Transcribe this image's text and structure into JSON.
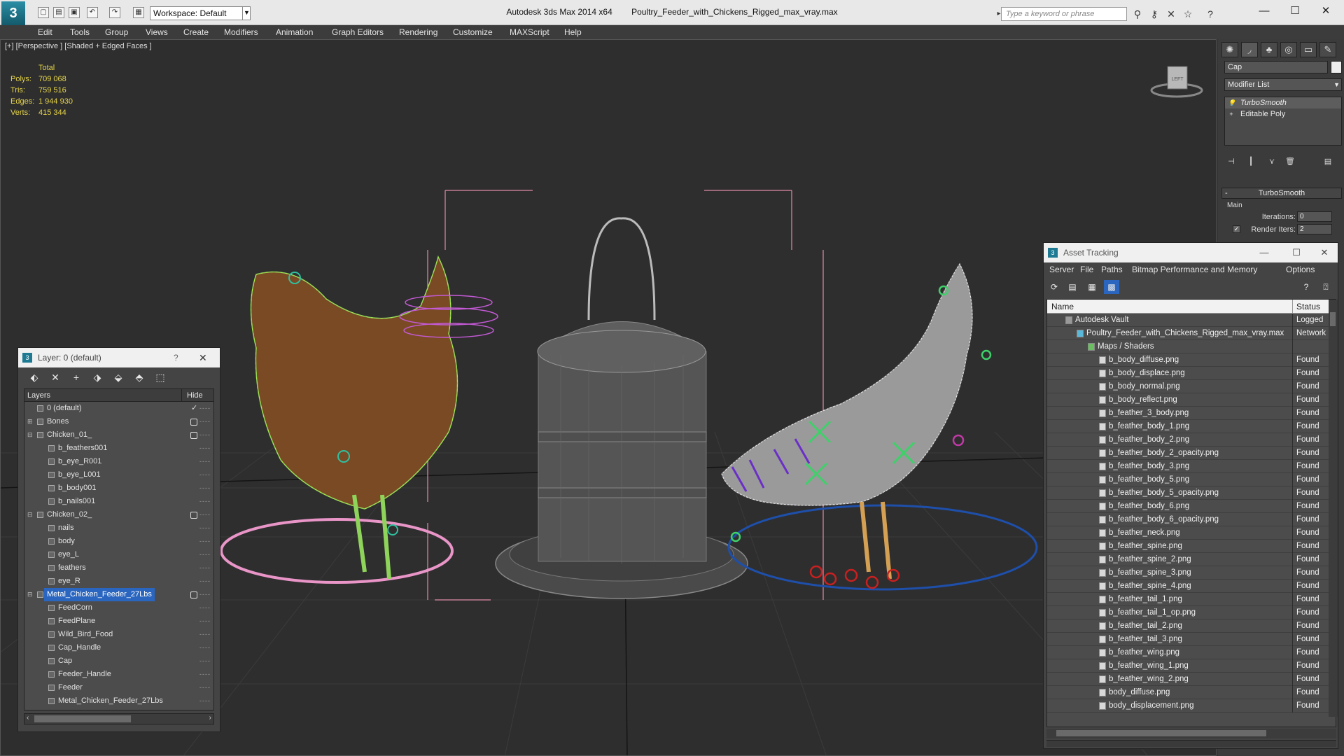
{
  "app": {
    "logo": "3",
    "workspace": "Workspace: Default",
    "product": "Autodesk 3ds Max  2014 x64",
    "file": "Poultry_Feeder_with_Chickens_Rigged_max_vray.max",
    "search_placeholder": "Type a keyword or phrase"
  },
  "menu": [
    "Edit",
    "Tools",
    "Group",
    "Views",
    "Create",
    "Modifiers",
    "Animation",
    "Graph Editors",
    "Rendering",
    "Customize",
    "MAXScript",
    "Help"
  ],
  "viewport": {
    "label": "[+] [Perspective ] [Shaded + Edged Faces ]",
    "stats": {
      "header": "Total",
      "rows": [
        {
          "label": "Polys:",
          "value": "709 068"
        },
        {
          "label": "Tris:",
          "value": "759 516"
        },
        {
          "label": "Edges:",
          "value": "1 944 930"
        },
        {
          "label": "Verts:",
          "value": "415 344"
        }
      ]
    },
    "viewcube_label": "LEFT"
  },
  "command_panel": {
    "object_name": "Cap",
    "modifier_list": "Modifier List",
    "stack": [
      "TurboSmooth",
      "Editable Poly"
    ],
    "rollout_title": "TurboSmooth",
    "main_label": "Main",
    "iterations_label": "Iterations:",
    "iterations_value": "0",
    "render_iters_label": "Render Iters:",
    "render_iters_value": "2"
  },
  "layer_window": {
    "title": "Layer: 0 (default)",
    "help": "?",
    "col_layers": "Layers",
    "col_hide": "Hide",
    "rows": [
      {
        "name": "0 (default)"
      },
      {
        "name": "Bones"
      },
      {
        "name": "Chicken_01_"
      },
      {
        "name": "b_feathers001"
      },
      {
        "name": "b_eye_R001"
      },
      {
        "name": "b_eye_L001"
      },
      {
        "name": "b_body001"
      },
      {
        "name": "b_nails001"
      },
      {
        "name": "Chicken_02_"
      },
      {
        "name": "nails"
      },
      {
        "name": "body"
      },
      {
        "name": "eye_L"
      },
      {
        "name": "feathers"
      },
      {
        "name": "eye_R"
      },
      {
        "name": "Metal_Chicken_Feeder_27Lbs"
      },
      {
        "name": "FeedCorn"
      },
      {
        "name": "FeedPlane"
      },
      {
        "name": "Wild_Bird_Food"
      },
      {
        "name": "Cap_Handle"
      },
      {
        "name": "Cap"
      },
      {
        "name": "Feeder_Handle"
      },
      {
        "name": "Feeder"
      },
      {
        "name": "Metal_Chicken_Feeder_27Lbs"
      }
    ]
  },
  "asset_window": {
    "title": "Asset Tracking",
    "menu": [
      "Server",
      "File",
      "Paths",
      "Bitmap Performance and Memory",
      "Options"
    ],
    "col_name": "Name",
    "col_status": "Status",
    "rows": [
      {
        "name": "Autodesk Vault",
        "status": "Logged"
      },
      {
        "name": "Poultry_Feeder_with_Chickens_Rigged_max_vray.max",
        "status": "Network"
      },
      {
        "name": "Maps / Shaders",
        "status": ""
      },
      {
        "name": "b_body_diffuse.png",
        "status": "Found"
      },
      {
        "name": "b_body_displace.png",
        "status": "Found"
      },
      {
        "name": "b_body_normal.png",
        "status": "Found"
      },
      {
        "name": "b_body_reflect.png",
        "status": "Found"
      },
      {
        "name": "b_feather_3_body.png",
        "status": "Found"
      },
      {
        "name": "b_feather_body_1.png",
        "status": "Found"
      },
      {
        "name": "b_feather_body_2.png",
        "status": "Found"
      },
      {
        "name": "b_feather_body_2_opacity.png",
        "status": "Found"
      },
      {
        "name": "b_feather_body_3.png",
        "status": "Found"
      },
      {
        "name": "b_feather_body_5.png",
        "status": "Found"
      },
      {
        "name": "b_feather_body_5_opacity.png",
        "status": "Found"
      },
      {
        "name": "b_feather_body_6.png",
        "status": "Found"
      },
      {
        "name": "b_feather_body_6_opacity.png",
        "status": "Found"
      },
      {
        "name": "b_feather_neck.png",
        "status": "Found"
      },
      {
        "name": "b_feather_spine.png",
        "status": "Found"
      },
      {
        "name": "b_feather_spine_2.png",
        "status": "Found"
      },
      {
        "name": "b_feather_spine_3.png",
        "status": "Found"
      },
      {
        "name": "b_feather_spine_4.png",
        "status": "Found"
      },
      {
        "name": "b_feather_tail_1.png",
        "status": "Found"
      },
      {
        "name": "b_feather_tail_1_op.png",
        "status": "Found"
      },
      {
        "name": "b_feather_tail_2.png",
        "status": "Found"
      },
      {
        "name": "b_feather_tail_3.png",
        "status": "Found"
      },
      {
        "name": "b_feather_wing.png",
        "status": "Found"
      },
      {
        "name": "b_feather_wing_1.png",
        "status": "Found"
      },
      {
        "name": "b_feather_wing_2.png",
        "status": "Found"
      },
      {
        "name": "body_diffuse.png",
        "status": "Found"
      },
      {
        "name": "body_displacement.png",
        "status": "Found"
      }
    ]
  },
  "colors": {
    "accent_selection": "#2a66c0",
    "stats_text": "#e6d44a",
    "viewport_bg": "#2e2e2e"
  }
}
